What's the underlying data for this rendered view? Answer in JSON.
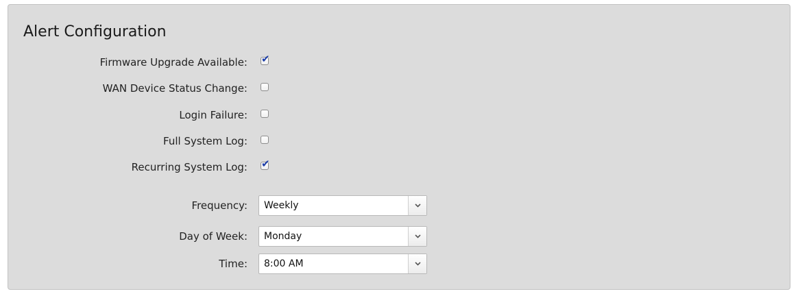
{
  "panel": {
    "title": "Alert Configuration"
  },
  "alerts": {
    "firmware_upgrade": {
      "label": "Firmware Upgrade Available:",
      "checked": true
    },
    "wan_device_status": {
      "label": "WAN Device Status Change:",
      "checked": false
    },
    "login_failure": {
      "label": "Login Failure:",
      "checked": false
    },
    "full_system_log": {
      "label": "Full System Log:",
      "checked": false
    },
    "recurring_system_log": {
      "label": "Recurring System Log:",
      "checked": true
    }
  },
  "schedule": {
    "frequency": {
      "label": "Frequency:",
      "value": "Weekly"
    },
    "day_of_week": {
      "label": "Day of Week:",
      "value": "Monday"
    },
    "time": {
      "label": "Time:",
      "value": "8:00 AM"
    }
  },
  "icons": {
    "check": "check-icon",
    "dropdown": "chevron-down-icon"
  },
  "colors": {
    "panel_bg": "#dcdcdc",
    "check_color": "#1d3ea8"
  }
}
